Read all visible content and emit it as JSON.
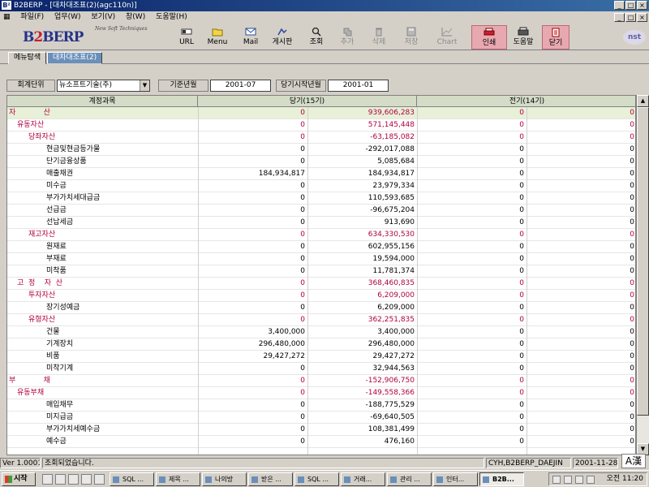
{
  "window": {
    "title": "B2BERP - [대차대조표(2)(agc110n)]",
    "controls": [
      "_",
      "□",
      "×"
    ]
  },
  "menu": {
    "items": [
      "파일(F)",
      "업무(W)",
      "보기(V)",
      "창(W)",
      "도움말(H)"
    ],
    "mdi_controls": [
      "_",
      "□",
      "×"
    ]
  },
  "logo": {
    "prefix": "B",
    "two": "2",
    "suffix": "BERP",
    "tagline": "New Soft Techniques"
  },
  "toolbar": {
    "buttons": [
      {
        "label": "URL",
        "icon": "url-icon",
        "enabled": true
      },
      {
        "label": "Menu",
        "icon": "folder-icon",
        "enabled": true
      },
      {
        "label": "Mail",
        "icon": "mail-icon",
        "enabled": true
      },
      {
        "label": "게시판",
        "icon": "board-icon",
        "enabled": true
      },
      {
        "label": "조회",
        "icon": "search-icon",
        "enabled": true
      },
      {
        "label": "추가",
        "icon": "add-icon",
        "enabled": false
      },
      {
        "label": "삭제",
        "icon": "trash-icon",
        "enabled": false
      },
      {
        "label": "저장",
        "icon": "save-icon",
        "enabled": false
      },
      {
        "label": "Chart",
        "icon": "chart-icon",
        "enabled": false
      },
      {
        "label": "인쇄",
        "icon": "print-icon",
        "enabled": true
      },
      {
        "label": "도움말",
        "icon": "help-icon",
        "enabled": true
      },
      {
        "label": "닫기",
        "icon": "close-icon",
        "enabled": true
      }
    ],
    "brand_badge": "nst"
  },
  "tabs": [
    "메뉴탐색",
    "대차대조표(2)"
  ],
  "filters": {
    "unit_label": "회계단위",
    "unit_value": "뉴소프트기술(주)",
    "base_month_label": "기준년월",
    "base_month_value": "2001-07",
    "start_month_label": "당기시작년월",
    "start_month_value": "2001-01"
  },
  "table": {
    "headers": [
      "계정과목",
      "당기(15기)",
      "",
      "전기(14기)",
      ""
    ],
    "rows": [
      {
        "account": "자            산",
        "cur_a": "0",
        "cur_b": "939,606,283",
        "prev_a": "0",
        "prev_b": "0",
        "level": 0,
        "highlight": true
      },
      {
        "account": "유동자산",
        "cur_a": "0",
        "cur_b": "571,145,448",
        "prev_a": "0",
        "prev_b": "0",
        "level": 1
      },
      {
        "account": "당좌자산",
        "cur_a": "0",
        "cur_b": "-63,185,082",
        "prev_a": "0",
        "prev_b": "0",
        "level": 2
      },
      {
        "account": "현금및현금등가물",
        "cur_a": "0",
        "cur_b": "-292,017,088",
        "prev_a": "0",
        "prev_b": "0",
        "level": 3
      },
      {
        "account": "단기금융상품",
        "cur_a": "0",
        "cur_b": "5,085,684",
        "prev_a": "0",
        "prev_b": "0",
        "level": 3
      },
      {
        "account": "매출채권",
        "cur_a": "184,934,817",
        "cur_b": "184,934,817",
        "prev_a": "0",
        "prev_b": "0",
        "level": 3
      },
      {
        "account": "미수금",
        "cur_a": "0",
        "cur_b": "23,979,334",
        "prev_a": "0",
        "prev_b": "0",
        "level": 3
      },
      {
        "account": "부가가치세대급금",
        "cur_a": "0",
        "cur_b": "110,593,685",
        "prev_a": "0",
        "prev_b": "0",
        "level": 3
      },
      {
        "account": "선급금",
        "cur_a": "0",
        "cur_b": "-96,675,204",
        "prev_a": "0",
        "prev_b": "0",
        "level": 3
      },
      {
        "account": "선납세금",
        "cur_a": "0",
        "cur_b": "913,690",
        "prev_a": "0",
        "prev_b": "0",
        "level": 3
      },
      {
        "account": "재고자산",
        "cur_a": "0",
        "cur_b": "634,330,530",
        "prev_a": "0",
        "prev_b": "0",
        "level": 2
      },
      {
        "account": "원재료",
        "cur_a": "0",
        "cur_b": "602,955,156",
        "prev_a": "0",
        "prev_b": "0",
        "level": 3
      },
      {
        "account": "부재료",
        "cur_a": "0",
        "cur_b": "19,594,000",
        "prev_a": "0",
        "prev_b": "0",
        "level": 3
      },
      {
        "account": "미착품",
        "cur_a": "0",
        "cur_b": "11,781,374",
        "prev_a": "0",
        "prev_b": "0",
        "level": 3
      },
      {
        "account": "고  정    자  산",
        "cur_a": "0",
        "cur_b": "368,460,835",
        "prev_a": "0",
        "prev_b": "0",
        "level": 1
      },
      {
        "account": "투자자산",
        "cur_a": "0",
        "cur_b": "6,209,000",
        "prev_a": "0",
        "prev_b": "0",
        "level": 2
      },
      {
        "account": "장기성예금",
        "cur_a": "0",
        "cur_b": "6,209,000",
        "prev_a": "0",
        "prev_b": "0",
        "level": 3
      },
      {
        "account": "유형자산",
        "cur_a": "0",
        "cur_b": "362,251,835",
        "prev_a": "0",
        "prev_b": "0",
        "level": 2
      },
      {
        "account": "건물",
        "cur_a": "3,400,000",
        "cur_b": "3,400,000",
        "prev_a": "0",
        "prev_b": "0",
        "level": 3
      },
      {
        "account": "기계장치",
        "cur_a": "296,480,000",
        "cur_b": "296,480,000",
        "prev_a": "0",
        "prev_b": "0",
        "level": 3
      },
      {
        "account": "비품",
        "cur_a": "29,427,272",
        "cur_b": "29,427,272",
        "prev_a": "0",
        "prev_b": "0",
        "level": 3
      },
      {
        "account": "미착기계",
        "cur_a": "0",
        "cur_b": "32,944,563",
        "prev_a": "0",
        "prev_b": "0",
        "level": 3
      },
      {
        "account": "부            채",
        "cur_a": "0",
        "cur_b": "-152,906,750",
        "prev_a": "0",
        "prev_b": "0",
        "level": 0
      },
      {
        "account": "유동부채",
        "cur_a": "0",
        "cur_b": "-149,558,366",
        "prev_a": "0",
        "prev_b": "0",
        "level": 1
      },
      {
        "account": "매입채무",
        "cur_a": "0",
        "cur_b": "-188,775,529",
        "prev_a": "0",
        "prev_b": "0",
        "level": 3
      },
      {
        "account": "미지급금",
        "cur_a": "0",
        "cur_b": "-69,640,505",
        "prev_a": "0",
        "prev_b": "0",
        "level": 3
      },
      {
        "account": "부가가치세예수금",
        "cur_a": "0",
        "cur_b": "108,381,499",
        "prev_a": "0",
        "prev_b": "0",
        "level": 3
      },
      {
        "account": "예수금",
        "cur_a": "0",
        "cur_b": "476,160",
        "prev_a": "0",
        "prev_b": "0",
        "level": 3
      }
    ]
  },
  "statusbar": {
    "version": "Ver 1.0001",
    "message": "조회되었습니다.",
    "user": "CYH,B2BERP_DAEJIN",
    "date": "2001-11-28",
    "ime": "A漢"
  },
  "taskbar": {
    "start": "시작",
    "tasks": [
      "SQL ...",
      "제목 ...",
      "나의방",
      "받은 ...",
      "SQL ...",
      "거래...",
      "관리 ...",
      "인터...",
      "B2B..."
    ],
    "active_task": 8,
    "clock": "오전 11:20"
  },
  "colors": {
    "accent": "#b00040",
    "header_bg": "#d4dcc8",
    "title_bg": "#0a246a",
    "tab_active": "#6b8fb9"
  }
}
